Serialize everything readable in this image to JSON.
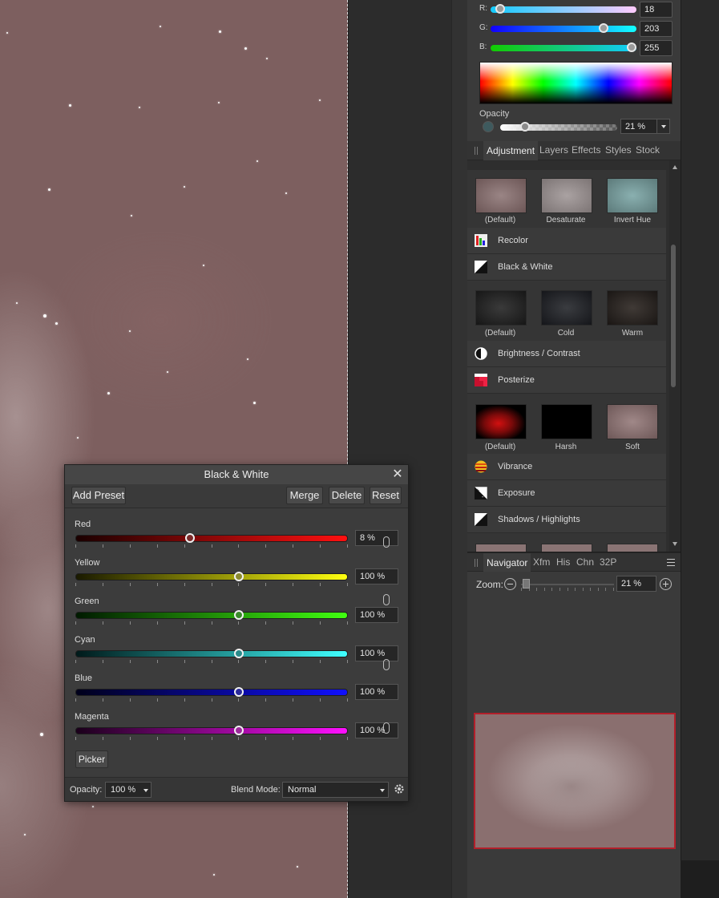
{
  "color_panel": {
    "r_label": "R:",
    "r_value": "18",
    "r_level": 0.07,
    "g_label": "G:",
    "g_value": "203",
    "g_level": 0.8,
    "b_label": "B:",
    "b_value": "255",
    "b_level": 1.0,
    "opacity_label": "Opacity",
    "opacity_value": "21 %",
    "opacity_level": 0.21
  },
  "studio_tabs": [
    "Adjustment",
    "Layers",
    "Effects",
    "Styles",
    "Stock"
  ],
  "adjustments": {
    "row1_captions": [
      "(Default)",
      "Desaturate",
      "Invert Hue"
    ],
    "items": [
      {
        "label": "Recolor",
        "icon": "recolor-icon"
      },
      {
        "label": "Black & White",
        "icon": "black-white-icon"
      },
      {
        "label": "Brightness / Contrast",
        "icon": "brightness-contrast-icon"
      },
      {
        "label": "Posterize",
        "icon": "posterize-icon"
      },
      {
        "label": "Vibrance",
        "icon": "vibrance-icon"
      },
      {
        "label": "Exposure",
        "icon": "exposure-icon"
      },
      {
        "label": "Shadows / Highlights",
        "icon": "shadows-highlights-icon"
      }
    ],
    "bw_captions": [
      "(Default)",
      "Cold",
      "Warm"
    ],
    "posterize_captions": [
      "(Default)",
      "Harsh",
      "Soft"
    ]
  },
  "navigator": {
    "tabs": [
      "Navigator",
      "Xfm",
      "His",
      "Chn",
      "32P"
    ],
    "zoom_label": "Zoom:",
    "zoom_value": "21 %",
    "zoom_level": 0.05
  },
  "bw_dialog": {
    "title": "Black & White",
    "buttons": {
      "add_preset": "Add Preset",
      "merge": "Merge",
      "delete": "Delete",
      "reset": "Reset"
    },
    "channels": [
      {
        "name": "Red",
        "value": "8 %",
        "level": 0.42,
        "track_from": "#1a0000",
        "track_to": "#ff1010",
        "knob": "#7a2a2a"
      },
      {
        "name": "Yellow",
        "value": "100 %",
        "level": 0.6,
        "track_from": "#1a1a00",
        "track_to": "#ffff10",
        "knob": "#8a8a30"
      },
      {
        "name": "Green",
        "value": "100 %",
        "level": 0.6,
        "track_from": "#001a00",
        "track_to": "#40ff10",
        "knob": "#3a8a2a"
      },
      {
        "name": "Cyan",
        "value": "100 %",
        "level": 0.6,
        "track_from": "#001a1a",
        "track_to": "#40ffff",
        "knob": "#2a8a8a"
      },
      {
        "name": "Blue",
        "value": "100 %",
        "level": 0.6,
        "track_from": "#00001a",
        "track_to": "#1010ff",
        "knob": "#2a2a9a"
      },
      {
        "name": "Magenta",
        "value": "100 %",
        "level": 0.6,
        "track_from": "#1a001a",
        "track_to": "#ff10ff",
        "knob": "#9a2a9a"
      }
    ],
    "picker_label": "Picker",
    "opacity_label": "Opacity:",
    "opacity_value": "100 %",
    "blend_label": "Blend Mode:",
    "blend_value": "Normal"
  }
}
